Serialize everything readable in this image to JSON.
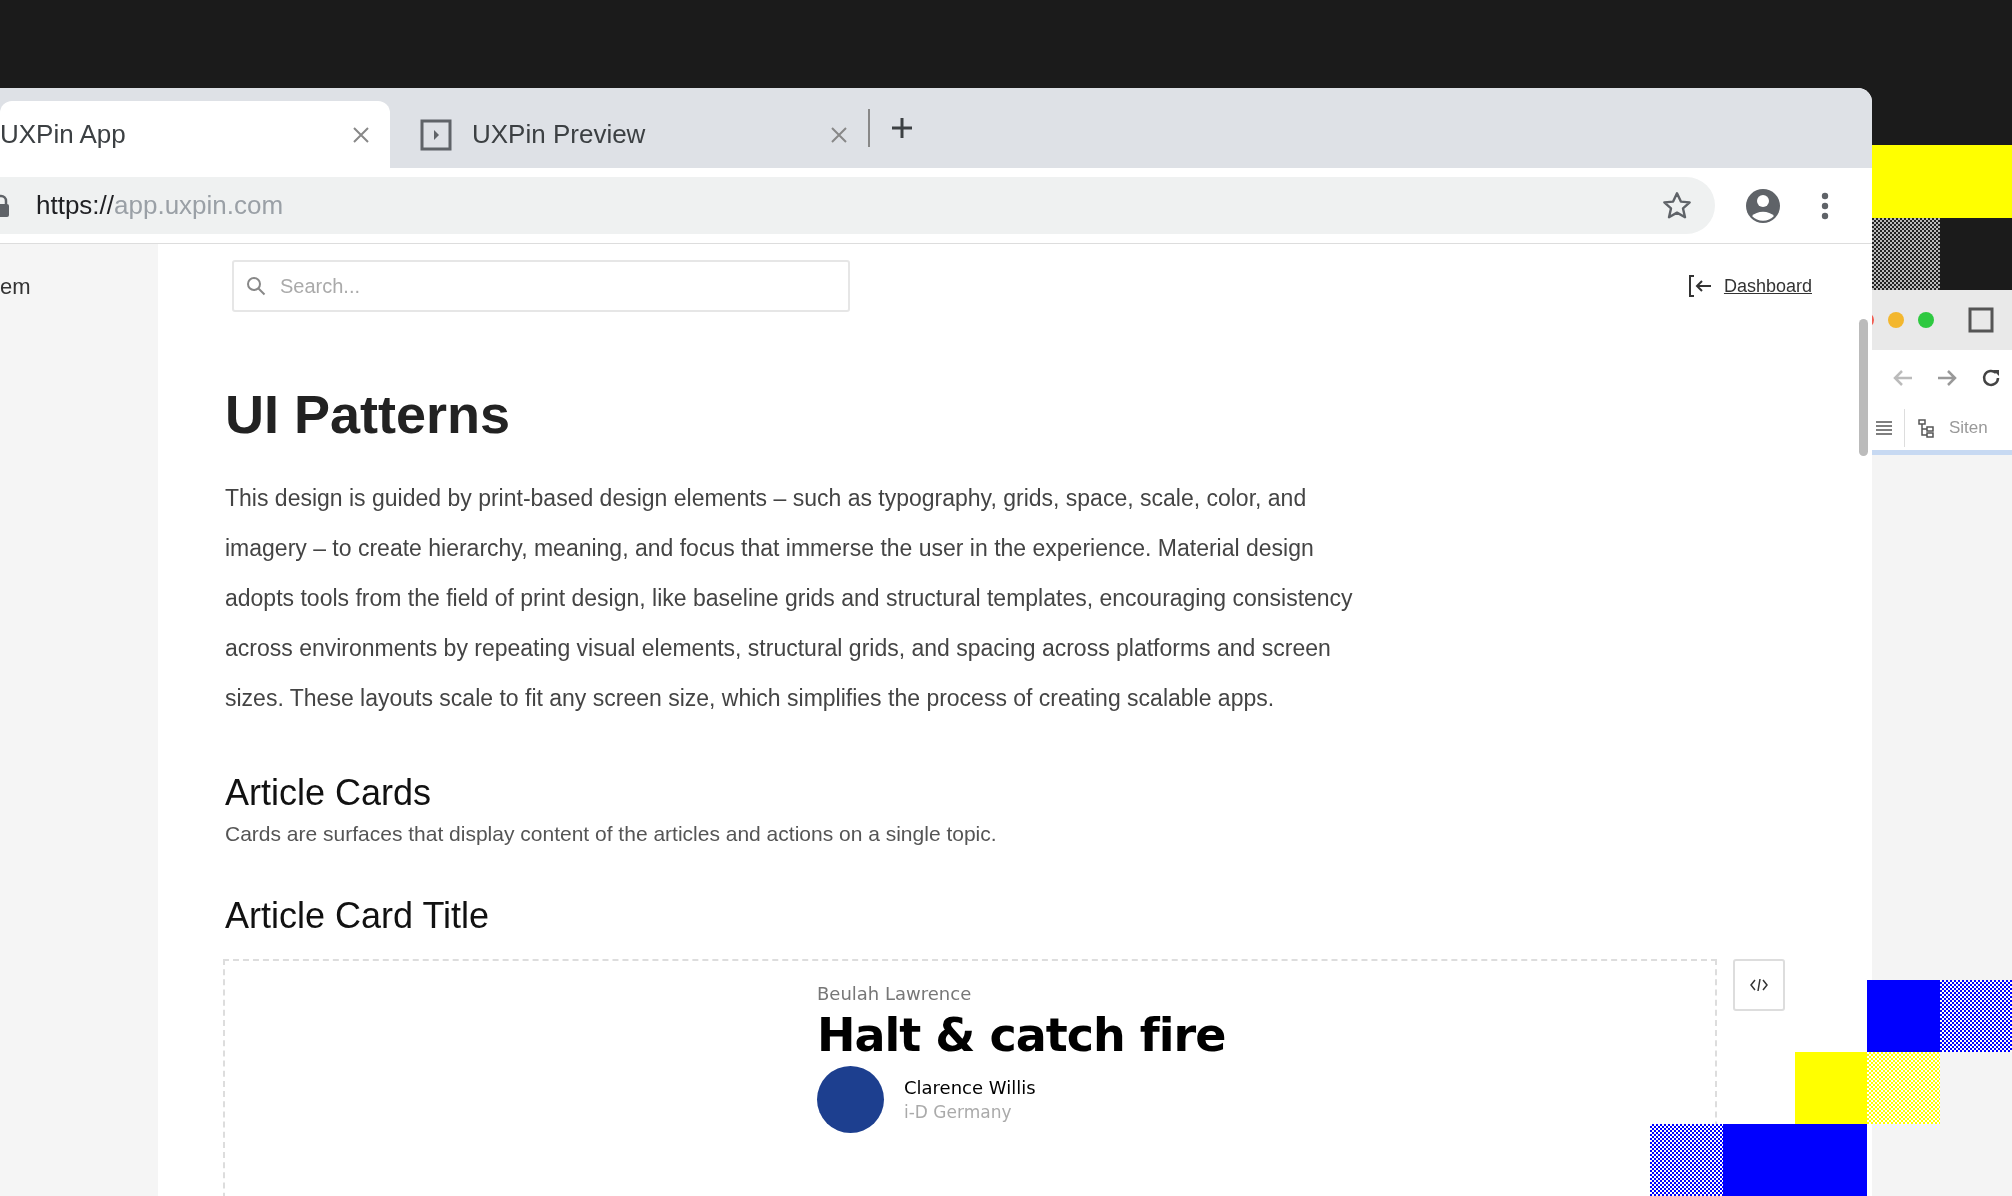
{
  "tabs": [
    {
      "title": "UXPin App",
      "selected": true,
      "show_icon": false
    },
    {
      "title": "UXPin Preview",
      "selected": false,
      "show_icon": true
    }
  ],
  "address_bar": {
    "scheme": "https://",
    "host": "app.uxpin.com"
  },
  "sidebar": {
    "items": [
      {
        "label": "em"
      }
    ]
  },
  "search": {
    "placeholder": "Search..."
  },
  "dashboard_link": "Dashboard",
  "page": {
    "title": "UI Patterns",
    "intro": "This design is guided by print-based design elements – such as typography, grids, space, scale, color, and imagery – to create hierarchy, meaning, and focus that immerse the user in the experience. Material design adopts tools from the field of print design, like baseline grids and structural templates, encouraging consistency across environments by repeating visual elements, structural grids, and spacing across platforms and screen sizes. These layouts scale to fit any screen size, which simplifies the process of creating scalable apps.",
    "section": {
      "title": "Article Cards",
      "description": "Cards are surfaces that display content of the articles and actions on a single topic."
    },
    "example": {
      "title": "Article Card Title",
      "card": {
        "author": "Beulah Lawrence",
        "headline": "Halt & catch fire",
        "byline_name": "Clarence Willis",
        "byline_source": "i-D Germany"
      }
    }
  },
  "side_window": {
    "toolbar_label": "Siten"
  }
}
